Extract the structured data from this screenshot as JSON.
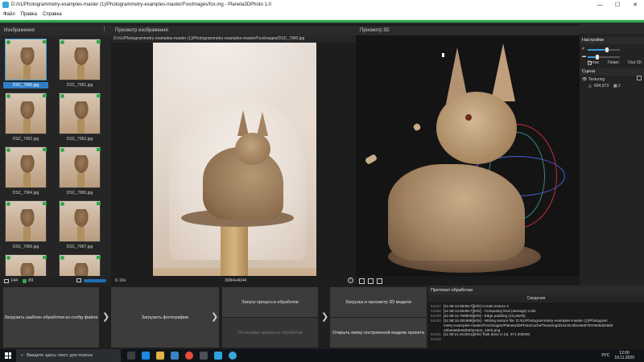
{
  "window": {
    "title": "D:/n1/Photogrammetry-examples-master (1)/Photogrammetry-examples-master/Fox/images/fox.mg - Planeta3DPhoto 1.0",
    "minimize": "—",
    "maximize": "☐",
    "close": "✕"
  },
  "menu": [
    "Файл",
    "Правка",
    "Справка"
  ],
  "images_panel": {
    "title": "Изображения",
    "thumbnails": [
      "DSC_7960.jpg",
      "DSC_7961.jpg",
      "DSC_7962.jpg",
      "DSC_7963.jpg",
      "DSC_7964.jpg",
      "DSC_7965.jpg",
      "DSC_7966.jpg",
      "DSC_7967.jpg",
      "",
      ""
    ],
    "selected_index": 0,
    "count_total": "144",
    "count_green": "89"
  },
  "preview_panel": {
    "title": "Просмотр изображения",
    "path": "D:/n1/Photogrammetry-examples-master (1)/Photogrammetry-examples-master/Fox/images/DSC_7960.jpg",
    "zoom": "0.16x",
    "dimensions": "3084x4044"
  },
  "view3d_panel": {
    "title": "Просмотр 3D"
  },
  "settings": {
    "title": "Настройки",
    "slider1_icon": "#",
    "slider1_level": 0.6,
    "slider2_level": 0.3,
    "toggles": [
      "Сетка",
      "Гизмо",
      "Оси СК"
    ],
    "toggle_states": [
      false,
      true,
      false
    ]
  },
  "scene": {
    "title": "Сцена",
    "item_name": "Texturing",
    "item_stats_vertices": "694,973",
    "item_stats_textures": "2"
  },
  "workflow": {
    "load_template": "Загрузить шаблон обработки из config файле",
    "load_photos": "Загрузить фотографии",
    "start_processing": "Запуск процесса обработки",
    "stop_processing": "Остановка процесса обработки",
    "load_view_3d": "Загрузка и просмотр 3D модели",
    "open_model_folder": "Открыть папку построенной модели проекта"
  },
  "log": {
    "title": "Протокол обработки",
    "column": "Сведения",
    "lines": [
      {
        "num": "54187",
        "msg": "[11:58:13.963817][info]  Create texture 2"
      },
      {
        "num": "54188",
        "msg": "[11:58:13.963817][info]   - Computing final (average) color."
      },
      {
        "num": "54189",
        "msg": "[11:58:14.769900][info]   - Edge padding (15 pixels)."
      },
      {
        "num": "54190",
        "msg": "[11:58:15.481998][info]   - Writing texture file: D:/n1/Photogrammetry-examples-master (1)/Photogram"
      },
      {
        "num": "",
        "msg": "metry-examples-master/Fox/images/Planeta3DPhotoCache/Texturing/d1e2c5c3bce6e5797e605d3c569"
      },
      {
        "num": "",
        "msg": "22ba0a5be63b9/texture_1002.png"
      },
      {
        "num": "54191",
        "msg": "[11:58:21.912531][info]  Task done in (s): 271.202000"
      },
      {
        "num": "54192",
        "msg": ""
      }
    ]
  },
  "taskbar": {
    "search_placeholder": "Введите здесь текст для поиска",
    "language": "РУС",
    "time": "12:00",
    "date": "19.11.2020"
  }
}
